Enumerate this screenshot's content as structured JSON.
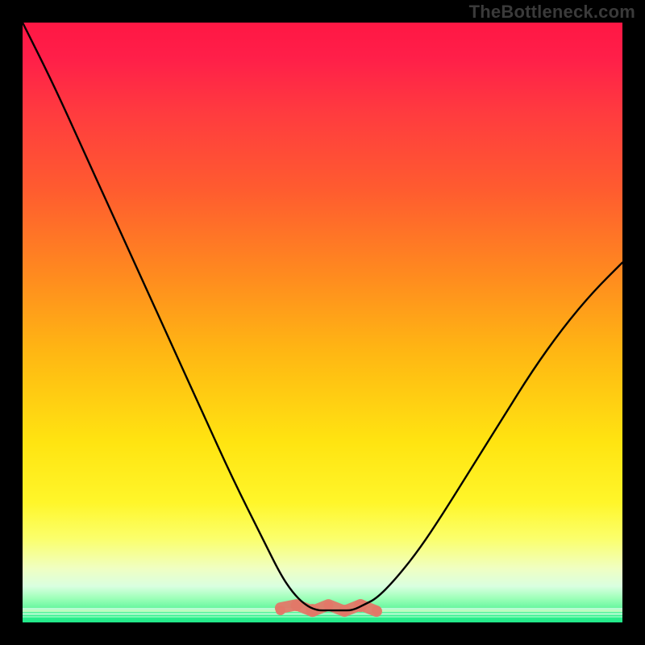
{
  "watermark": "TheBottleneck.com",
  "colors": {
    "frame": "#000000",
    "curve": "#000000",
    "flat_highlight": "#e17868",
    "gradient_top": "#ff1744",
    "gradient_bottom": "#21e88a"
  },
  "chart_data": {
    "type": "line",
    "title": "",
    "xlabel": "",
    "ylabel": "",
    "xlim": [
      0,
      100
    ],
    "ylim": [
      0,
      100
    ],
    "grid": false,
    "legend": false,
    "series": [
      {
        "name": "bottleneck-curve",
        "x": [
          0,
          5,
          10,
          15,
          20,
          25,
          30,
          35,
          40,
          43,
          45,
          47,
          49,
          51,
          53,
          55,
          57,
          59,
          62,
          66,
          70,
          75,
          80,
          85,
          90,
          95,
          100
        ],
        "y": [
          100,
          90,
          79,
          68,
          57,
          46,
          35,
          24,
          14,
          8,
          5,
          3,
          2,
          2,
          2,
          2,
          3,
          4,
          7,
          12,
          18,
          26,
          34,
          42,
          49,
          55,
          60
        ]
      }
    ],
    "highlight_flat_region": {
      "x_start": 43,
      "x_end": 59,
      "y_approx": 2
    }
  }
}
